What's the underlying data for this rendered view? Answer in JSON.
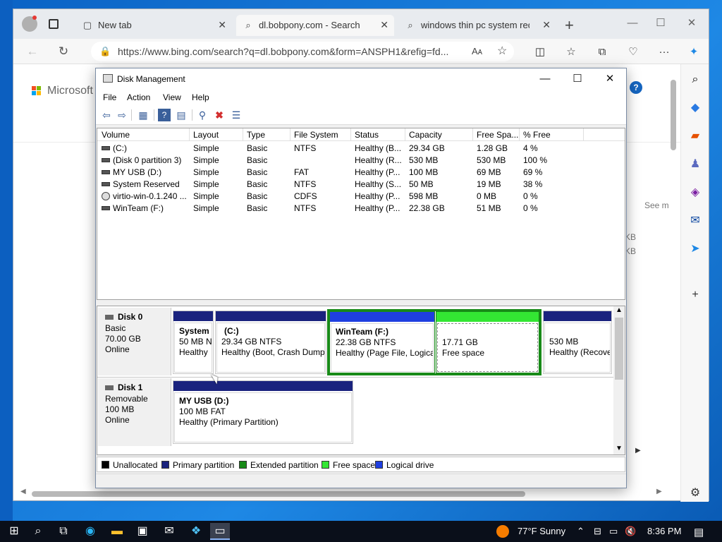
{
  "browser": {
    "tabs": [
      {
        "label": "New tab",
        "icon": "tab-page-icon",
        "close": "✕"
      },
      {
        "label": "dl.bobpony.com - Search",
        "icon": "search-icon",
        "close": "✕"
      },
      {
        "label": "windows thin pc system requ",
        "icon": "search-icon",
        "close": "✕"
      }
    ],
    "new_tab": "+",
    "address": "https://www.bing.com/search?q=dl.bobpony.com&form=ANSPH1&refig=fd...",
    "aa": "Aᴀ",
    "page": {
      "brand": "Microsoft",
      "peek_see_more": "See m",
      "peek_kb1": "KB",
      "peek_kb2": "KB"
    }
  },
  "window": {
    "title": "Disk Management",
    "menu": [
      "File",
      "Action",
      "View",
      "Help"
    ]
  },
  "volumes": {
    "headers": [
      "Volume",
      "Layout",
      "Type",
      "File System",
      "Status",
      "Capacity",
      "Free Spa...",
      "% Free"
    ],
    "rows": [
      {
        "volume": "(C:)",
        "layout": "Simple",
        "type": "Basic",
        "fs": "NTFS",
        "status": "Healthy (B...",
        "capacity": "29.34 GB",
        "free": "1.28 GB",
        "pct": "4 %"
      },
      {
        "volume": "(Disk 0 partition 3)",
        "layout": "Simple",
        "type": "Basic",
        "fs": "",
        "status": "Healthy (R...",
        "capacity": "530 MB",
        "free": "530 MB",
        "pct": "100 %"
      },
      {
        "volume": "MY USB (D:)",
        "layout": "Simple",
        "type": "Basic",
        "fs": "FAT",
        "status": "Healthy (P...",
        "capacity": "100 MB",
        "free": "69 MB",
        "pct": "69 %"
      },
      {
        "volume": "System Reserved",
        "layout": "Simple",
        "type": "Basic",
        "fs": "NTFS",
        "status": "Healthy (S...",
        "capacity": "50 MB",
        "free": "19 MB",
        "pct": "38 %"
      },
      {
        "volume": "virtio-win-0.1.240 ...",
        "layout": "Simple",
        "type": "Basic",
        "fs": "CDFS",
        "status": "Healthy (P...",
        "capacity": "598 MB",
        "free": "0 MB",
        "pct": "0 %"
      },
      {
        "volume": "WinTeam (F:)",
        "layout": "Simple",
        "type": "Basic",
        "fs": "NTFS",
        "status": "Healthy (P...",
        "capacity": "22.38 GB",
        "free": "51 MB",
        "pct": "0 %"
      }
    ]
  },
  "disks": [
    {
      "name": "Disk 0",
      "kind": "Basic",
      "size": "70.00 GB",
      "state": "Online",
      "partitions": [
        {
          "title": "System",
          "line1": "50 MB N",
          "line2": "Healthy"
        },
        {
          "title": "(C:)",
          "line1": "29.34 GB NTFS",
          "line2": "Healthy (Boot, Crash Dump"
        },
        {
          "title": "WinTeam  (F:)",
          "line1": "22.38 GB NTFS",
          "line2": "Healthy (Page File, Logica"
        },
        {
          "title": "17.71 GB",
          "line1": "Free space",
          "line2": ""
        },
        {
          "title": "530 MB",
          "line1": "Healthy (Recove",
          "line2": ""
        }
      ]
    },
    {
      "name": "Disk 1",
      "kind": "Removable",
      "size": "100 MB",
      "state": "Online",
      "partitions": [
        {
          "title": "MY USB  (D:)",
          "line1": "100 MB FAT",
          "line2": "Healthy (Primary Partition)"
        }
      ]
    }
  ],
  "legend": [
    {
      "label": "Unallocated",
      "color": "#000000"
    },
    {
      "label": "Primary partition",
      "color": "#1a237e"
    },
    {
      "label": "Extended partition",
      "color": "#188a18"
    },
    {
      "label": "Free space",
      "color": "#33e633"
    },
    {
      "label": "Logical drive",
      "color": "#1f3fe0"
    }
  ],
  "colors": {
    "primary": "#1a237e",
    "logical": "#1f3fe0",
    "extended": "#188a18",
    "free": "#33e633"
  },
  "taskbar": {
    "weather": "77°F  Sunny",
    "time": "8:36 PM"
  }
}
